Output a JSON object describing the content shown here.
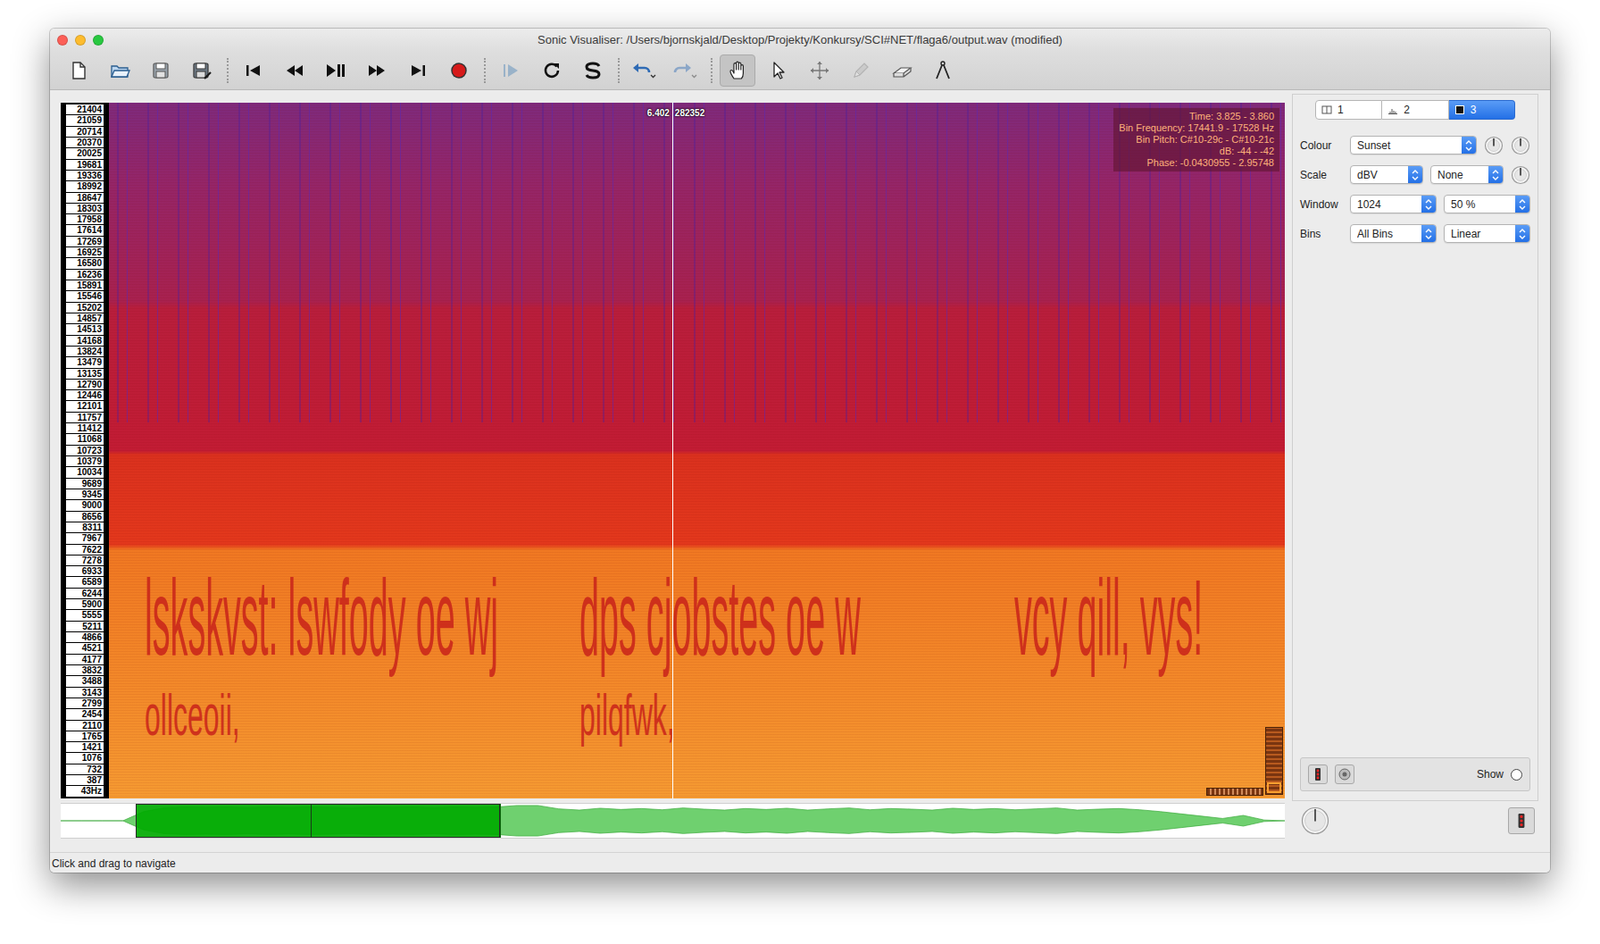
{
  "window": {
    "title": "Sonic Visualiser: /Users/bjornskjald/Desktop/Projekty/Konkursy/SCI#NET/flaga6/output.wav (modified)"
  },
  "toolbar": [
    [
      {
        "kind": "new",
        "selected": false,
        "disabled": false
      },
      {
        "kind": "open",
        "selected": false,
        "disabled": false
      },
      {
        "kind": "save",
        "selected": false,
        "disabled": false
      },
      {
        "kind": "save-as",
        "selected": false,
        "disabled": false
      }
    ],
    [
      {
        "kind": "start",
        "selected": false,
        "disabled": false
      },
      {
        "kind": "rewind",
        "selected": false,
        "disabled": false
      },
      {
        "kind": "play",
        "selected": false,
        "disabled": false
      },
      {
        "kind": "fast-forward",
        "selected": false,
        "disabled": false
      },
      {
        "kind": "end",
        "selected": false,
        "disabled": false
      },
      {
        "kind": "record",
        "selected": false,
        "disabled": false
      }
    ],
    [
      {
        "kind": "play-selection",
        "selected": false,
        "disabled": true
      },
      {
        "kind": "loop",
        "selected": false,
        "disabled": false
      },
      {
        "kind": "solo",
        "selected": false,
        "disabled": false
      }
    ],
    [
      {
        "kind": "undo",
        "selected": false,
        "disabled": false
      },
      {
        "kind": "redo",
        "selected": false,
        "disabled": true
      }
    ],
    [
      {
        "kind": "navigate",
        "selected": true,
        "disabled": false
      },
      {
        "kind": "select",
        "selected": false,
        "disabled": false
      },
      {
        "kind": "move",
        "selected": false,
        "disabled": false
      },
      {
        "kind": "draw",
        "selected": false,
        "disabled": true
      },
      {
        "kind": "erase",
        "selected": false,
        "disabled": false
      },
      {
        "kind": "measure",
        "selected": false,
        "disabled": false
      }
    ]
  ],
  "pane": {
    "frequency_scale": [
      "21404",
      "21059",
      "20714",
      "20370",
      "20025",
      "19681",
      "19336",
      "18992",
      "18647",
      "18303",
      "17958",
      "17614",
      "17269",
      "16925",
      "16580",
      "16236",
      "15891",
      "15546",
      "15202",
      "14857",
      "14513",
      "14168",
      "13824",
      "13479",
      "13135",
      "12790",
      "12446",
      "12101",
      "11757",
      "11412",
      "11068",
      "10723",
      "10379",
      "10034",
      "9689",
      "9345",
      "9000",
      "8656",
      "8311",
      "7967",
      "7622",
      "7278",
      "6933",
      "6589",
      "6244",
      "5900",
      "5555",
      "5211",
      "4866",
      "4521",
      "4177",
      "3832",
      "3488",
      "3143",
      "2799",
      "2454",
      "2110",
      "1765",
      "1421",
      "1076",
      "732",
      "387",
      "43Hz"
    ],
    "playhead": {
      "position": 0.479,
      "time": "6.402",
      "frame": "282352"
    },
    "info": [
      "Time: 3.825 - 3.860",
      "Bin Frequency: 17441.9 - 17528 Hz",
      "Bin Pitch: C#10-29c - C#10-21c",
      "dB: -44 - -42",
      "Phase: -0.0430955 - 2.95748"
    ],
    "hidden_text": [
      {
        "lines": [
          "lskskvst: lswfody oe wj",
          "ollceoii,"
        ]
      },
      {
        "lines": [
          "dps cjobstes oe w",
          "pilqfwk,"
        ]
      },
      {
        "lines": [
          "vcy qill, vys!"
        ]
      }
    ]
  },
  "overview": {
    "view_start": 0.061,
    "view_end": 0.359,
    "playhead": 0.204,
    "amplitude": [
      0,
      0,
      0,
      0,
      0.6,
      0.85,
      0.9,
      0.88,
      0.9,
      0.86,
      0.9,
      0.87,
      0.9,
      0.88,
      0.85,
      0.9,
      0.88,
      0.9,
      0.86,
      0.9,
      0.88,
      0.9,
      1,
      1,
      0.78,
      0.7,
      0.82,
      0.74,
      0.8,
      0.72,
      0.84,
      0.76,
      0.7,
      0.8,
      0.74,
      0.82,
      0.7,
      0.78,
      0.84,
      0.72,
      0.8,
      0.76,
      0.7,
      0.82,
      0.74,
      0.8,
      0.72,
      0.78,
      0.84,
      0.7,
      0.76,
      0.8,
      0.72,
      0.6,
      0.45,
      0.3,
      0.15,
      0.35,
      0.05,
      0
    ]
  },
  "playback_speed": {
    "level": 0.5
  },
  "properties": {
    "tabs": [
      {
        "label": "1",
        "kind": "pane",
        "selected": false
      },
      {
        "label": "2",
        "kind": "waveform",
        "selected": false
      },
      {
        "label": "3",
        "kind": "spectrogram",
        "selected": true
      }
    ],
    "rows": [
      {
        "label": "Colour",
        "controls": [
          {
            "kind": "select",
            "value": "Sunset"
          },
          {
            "kind": "knob",
            "level": 0.5
          },
          {
            "kind": "knob",
            "level": 0.5
          }
        ]
      },
      {
        "label": "Scale",
        "controls": [
          {
            "kind": "select",
            "value": "dBV"
          },
          {
            "kind": "select",
            "value": "None"
          },
          {
            "kind": "knob",
            "level": 0.5
          }
        ]
      },
      {
        "label": "Window",
        "controls": [
          {
            "kind": "select",
            "value": "1024"
          },
          {
            "kind": "select",
            "value": "50 %"
          }
        ]
      },
      {
        "label": "Bins",
        "controls": [
          {
            "kind": "select",
            "value": "All Bins"
          },
          {
            "kind": "select",
            "value": "Linear"
          }
        ]
      }
    ],
    "show": {
      "label": "Show",
      "checked": false
    }
  },
  "status_bar": "Click and drag to navigate"
}
